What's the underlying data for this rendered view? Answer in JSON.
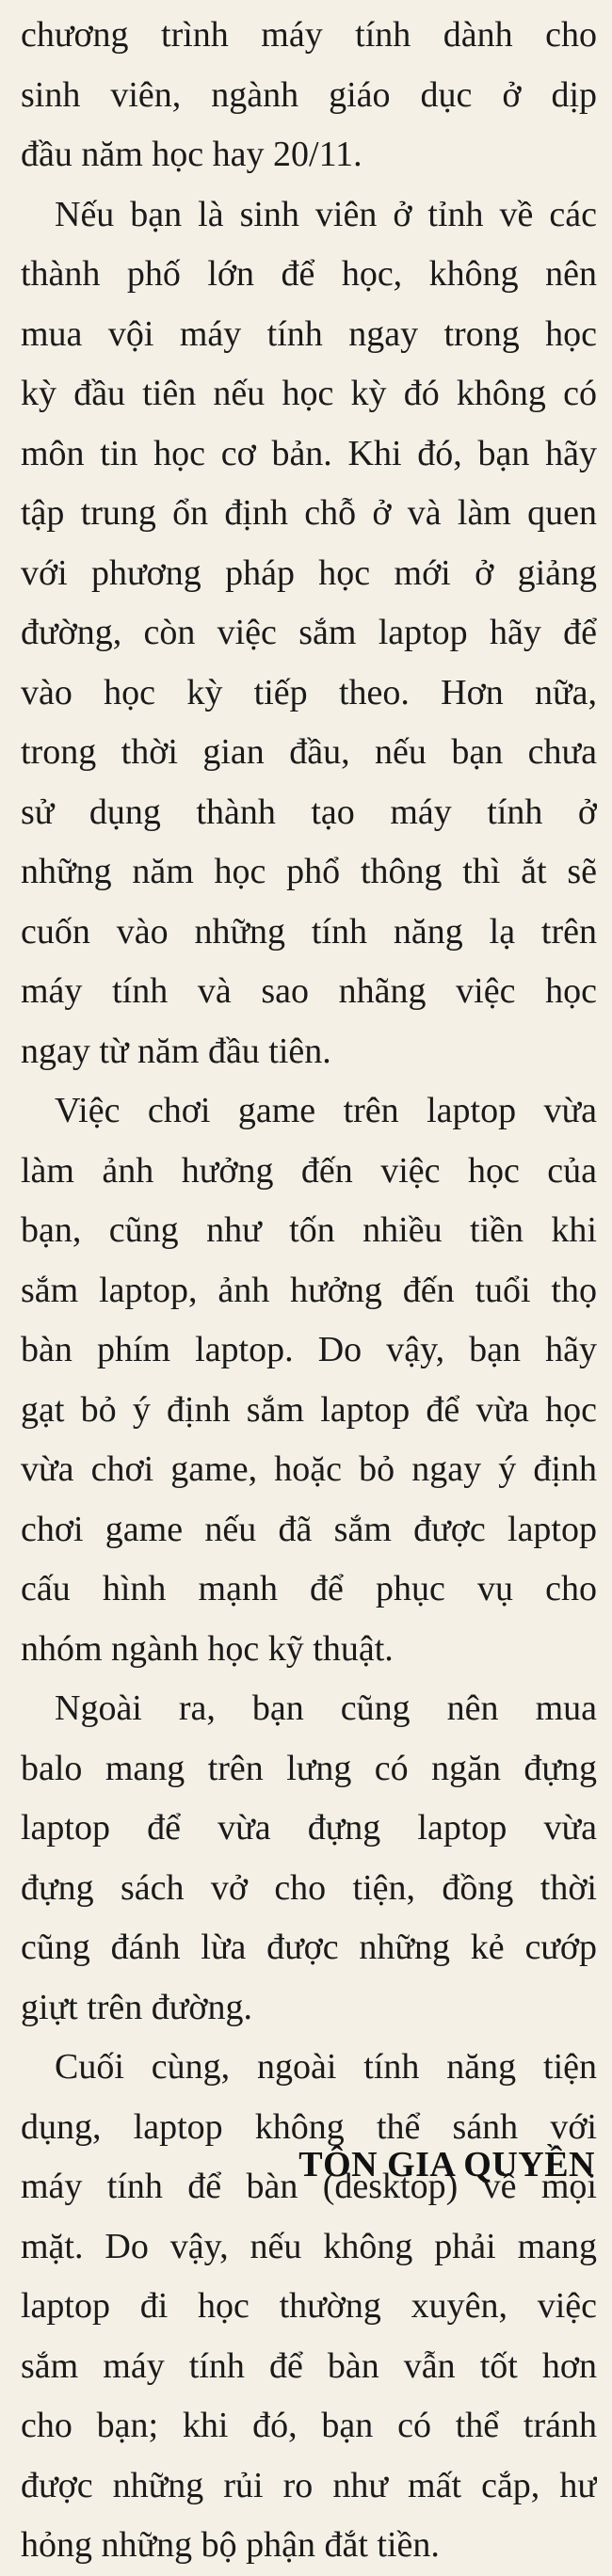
{
  "article": {
    "paragraphs": [
      {
        "lines": [
          "chương trình máy tính dành cho",
          "sinh viên, ngành giáo dục ở dịp",
          "đầu năm học hay 20/11."
        ]
      },
      {
        "lines": [
          "Nếu bạn là sinh viên ở tỉnh về các",
          "thành phố lớn để học, không nên",
          "mua vội máy tính ngay trong học",
          "kỳ đầu tiên nếu học kỳ đó không có",
          "môn tin học cơ bản. Khi đó, bạn hãy",
          "tập trung ổn định chỗ ở và làm quen",
          "với phương pháp học mới ở giảng",
          "đường, còn việc sắm laptop hãy để",
          "vào học kỳ tiếp theo. Hơn nữa,",
          "trong thời gian đầu, nếu bạn chưa",
          "sử dụng thành tạo máy tính ở",
          "những năm học phổ thông thì ắt sẽ",
          "cuốn vào những tính năng lạ trên",
          "máy tính và sao nhãng việc học",
          "ngay từ năm đầu tiên."
        ]
      },
      {
        "lines": [
          "Việc chơi game trên laptop vừa",
          "làm ảnh hưởng đến việc học của",
          "bạn, cũng như tốn nhiều tiền khi",
          "sắm laptop, ảnh hưởng đến tuổi thọ",
          "bàn phím laptop. Do vậy, bạn hãy",
          "gạt bỏ ý định sắm laptop để vừa học",
          "vừa chơi game, hoặc bỏ ngay ý định",
          "chơi game nếu đã sắm được laptop",
          "cấu hình mạnh để phục vụ cho",
          "nhóm ngành học kỹ thuật."
        ]
      },
      {
        "lines": [
          "Ngoài ra, bạn cũng nên mua",
          "balo mang trên lưng có ngăn đựng",
          "laptop để vừa đựng laptop vừa",
          "đựng sách vở cho tiện, đồng thời",
          "cũng đánh lừa được những kẻ cướp",
          "giựt trên đường."
        ]
      },
      {
        "lines": [
          "Cuối cùng, ngoài tính năng tiện",
          "dụng, laptop không thể sánh với",
          "máy tính để bàn (desktop) về mọi",
          "mặt. Do vậy, nếu không phải mang",
          "laptop đi học thường xuyên, việc",
          "sắm máy tính để bàn vẫn tốt hơn",
          "cho bạn; khi đó, bạn có thể tránh",
          "được những rủi ro như mất cắp, hư",
          "hỏng những bộ phận đắt tiền."
        ]
      }
    ],
    "byline": "TÔN GIA QUYỀN"
  }
}
